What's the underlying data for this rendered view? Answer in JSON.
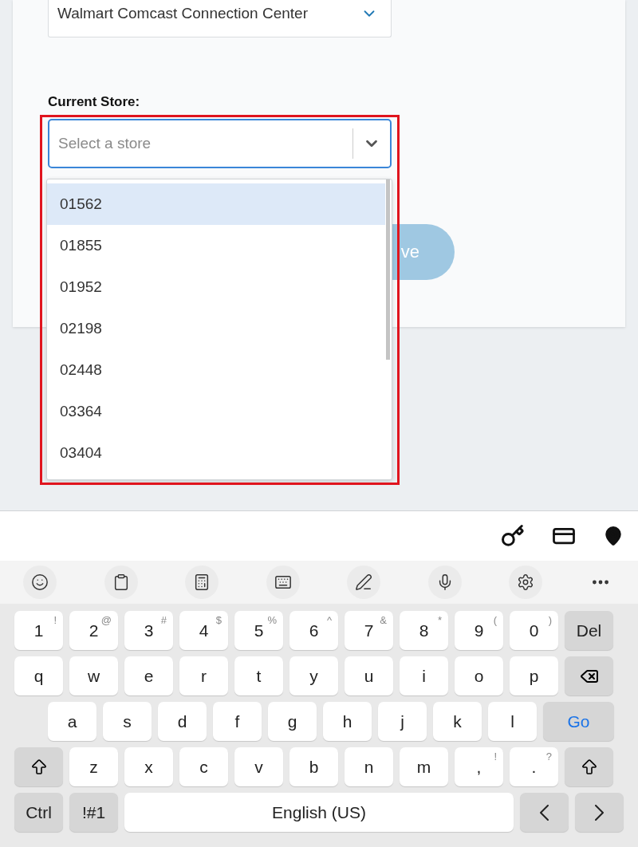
{
  "location_select": {
    "value": "Walmart Comcast Connection Center"
  },
  "current_store": {
    "label": "Current Store:",
    "placeholder": "Select a store"
  },
  "store_options": [
    {
      "label": "01562",
      "selected": true
    },
    {
      "label": "01855",
      "selected": false
    },
    {
      "label": "01952",
      "selected": false
    },
    {
      "label": "02198",
      "selected": false
    },
    {
      "label": "02448",
      "selected": false
    },
    {
      "label": "03364",
      "selected": false
    },
    {
      "label": "03404",
      "selected": false
    }
  ],
  "save_button": {
    "label": "ve"
  },
  "keyboard_rows": [
    [
      {
        "kind": "char",
        "label": "1",
        "hint": "!"
      },
      {
        "kind": "char",
        "label": "2",
        "hint": "@"
      },
      {
        "kind": "char",
        "label": "3",
        "hint": "#"
      },
      {
        "kind": "char",
        "label": "4",
        "hint": "$"
      },
      {
        "kind": "char",
        "label": "5",
        "hint": "%"
      },
      {
        "kind": "char",
        "label": "6",
        "hint": "^"
      },
      {
        "kind": "char",
        "label": "7",
        "hint": "&"
      },
      {
        "kind": "char",
        "label": "8",
        "hint": "*"
      },
      {
        "kind": "char",
        "label": "9",
        "hint": "("
      },
      {
        "kind": "char",
        "label": "0",
        "hint": ")"
      },
      {
        "kind": "mod",
        "label": "Del"
      }
    ],
    [
      {
        "kind": "char",
        "label": "q"
      },
      {
        "kind": "char",
        "label": "w"
      },
      {
        "kind": "char",
        "label": "e"
      },
      {
        "kind": "char",
        "label": "r"
      },
      {
        "kind": "char",
        "label": "t"
      },
      {
        "kind": "char",
        "label": "y"
      },
      {
        "kind": "char",
        "label": "u"
      },
      {
        "kind": "char",
        "label": "i"
      },
      {
        "kind": "char",
        "label": "o"
      },
      {
        "kind": "char",
        "label": "p"
      },
      {
        "kind": "backspace"
      }
    ],
    [
      {
        "kind": "char",
        "label": "a"
      },
      {
        "kind": "char",
        "label": "s"
      },
      {
        "kind": "char",
        "label": "d"
      },
      {
        "kind": "char",
        "label": "f"
      },
      {
        "kind": "char",
        "label": "g"
      },
      {
        "kind": "char",
        "label": "h"
      },
      {
        "kind": "char",
        "label": "j"
      },
      {
        "kind": "char",
        "label": "k"
      },
      {
        "kind": "char",
        "label": "l"
      },
      {
        "kind": "go",
        "label": "Go"
      }
    ],
    [
      {
        "kind": "shift"
      },
      {
        "kind": "char",
        "label": "z"
      },
      {
        "kind": "char",
        "label": "x"
      },
      {
        "kind": "char",
        "label": "c"
      },
      {
        "kind": "char",
        "label": "v"
      },
      {
        "kind": "char",
        "label": "b"
      },
      {
        "kind": "char",
        "label": "n"
      },
      {
        "kind": "char",
        "label": "m"
      },
      {
        "kind": "char",
        "label": ",",
        "hint": "!"
      },
      {
        "kind": "char",
        "label": ".",
        "hint": "?"
      },
      {
        "kind": "shift"
      }
    ],
    [
      {
        "kind": "mod",
        "label": "Ctrl"
      },
      {
        "kind": "mod",
        "label": "!#1"
      },
      {
        "kind": "space",
        "label": "English (US)"
      },
      {
        "kind": "left"
      },
      {
        "kind": "right"
      }
    ]
  ]
}
